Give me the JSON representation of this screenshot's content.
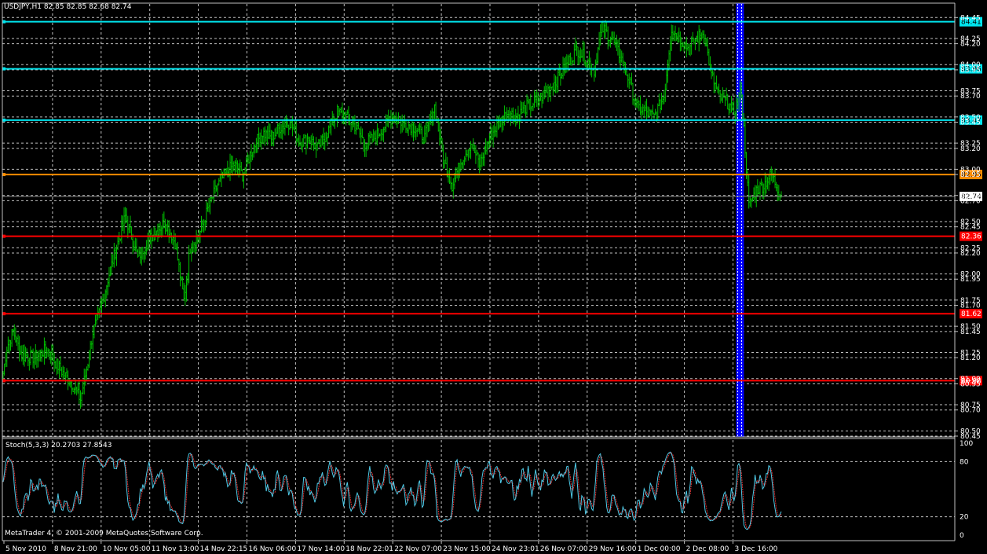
{
  "window": {
    "symbol_info": "USDJPY,H1  82.85 82.85 82.68 82.74",
    "stoch_info": "Stoch(5,3,3) 20.2703 27.8543",
    "copyright": "MetaTrader 4, © 2001-2009 MetaQuotes Software Corp."
  },
  "colors": {
    "background": "#000000",
    "grid": "#c0c0c0",
    "bars": "#00c000",
    "cyan_level": "#00e5ee",
    "orange_level": "#ff8c00",
    "red_level": "#ff0000",
    "highlight_band": "#0000ff",
    "stoch_main": "#4ec9e6",
    "stoch_signal": "#e03030"
  },
  "chart_data": [
    {
      "type": "line",
      "title": "USDJPY,H1",
      "ylim": [
        80.45,
        84.58
      ],
      "price_ticks": [
        "84.45",
        "84.25",
        "84.20",
        "84.00",
        "83.95",
        "83.75",
        "83.70",
        "83.50",
        "83.45",
        "83.25",
        "83.20",
        "83.00",
        "82.95",
        "82.75",
        "82.70",
        "82.50",
        "82.45",
        "82.25",
        "82.20",
        "82.00",
        "81.95",
        "81.75",
        "81.70",
        "81.50",
        "81.45",
        "81.25",
        "81.20",
        "81.00",
        "80.95",
        "80.75",
        "80.70",
        "80.50",
        "80.45"
      ],
      "current_price": 82.74,
      "levels": [
        {
          "label": "84.41",
          "value": 84.41,
          "kind": "cyan"
        },
        {
          "label": "83.96",
          "value": 83.96,
          "kind": "cyan"
        },
        {
          "label": "83.47",
          "value": 83.47,
          "kind": "cyan"
        },
        {
          "label": "82.95",
          "value": 82.95,
          "kind": "orange"
        },
        {
          "label": "82.36",
          "value": 82.36,
          "kind": "red"
        },
        {
          "label": "81.62",
          "value": 81.62,
          "kind": "red"
        },
        {
          "label": "80.98",
          "value": 80.98,
          "kind": "red"
        }
      ],
      "x_labels": [
        "5 Nov 2010",
        "8 Nov 21:00",
        "10 Nov 05:00",
        "11 Nov 13:00",
        "14 Nov 22:15",
        "16 Nov 06:00",
        "17 Nov 14:00",
        "18 Nov 22:01",
        "22 Nov 07:00",
        "23 Nov 15:00",
        "24 Nov 23:01",
        "26 Nov 07:00",
        "29 Nov 16:00",
        "1 Dec 00:00",
        "2 Dec 08:00",
        "3 Dec 16:00"
      ],
      "highlight_index": 15,
      "close_keypoints": [
        [
          0,
          81.05
        ],
        [
          3,
          81.3
        ],
        [
          8,
          81.45
        ],
        [
          15,
          81.22
        ],
        [
          25,
          81.2
        ],
        [
          35,
          81.28
        ],
        [
          45,
          81.1
        ],
        [
          55,
          80.95
        ],
        [
          62,
          80.8
        ],
        [
          68,
          81.15
        ],
        [
          72,
          81.45
        ],
        [
          78,
          81.65
        ],
        [
          85,
          82.0
        ],
        [
          92,
          82.3
        ],
        [
          98,
          82.55
        ],
        [
          102,
          82.4
        ],
        [
          108,
          82.15
        ],
        [
          115,
          82.3
        ],
        [
          122,
          82.4
        ],
        [
          130,
          82.5
        ],
        [
          138,
          82.3
        ],
        [
          145,
          81.75
        ],
        [
          150,
          82.25
        ],
        [
          158,
          82.4
        ],
        [
          165,
          82.65
        ],
        [
          172,
          82.85
        ],
        [
          178,
          82.95
        ],
        [
          185,
          83.05
        ],
        [
          192,
          82.95
        ],
        [
          200,
          83.2
        ],
        [
          208,
          83.35
        ],
        [
          215,
          83.3
        ],
        [
          222,
          83.4
        ],
        [
          230,
          83.45
        ],
        [
          238,
          83.25
        ],
        [
          245,
          83.3
        ],
        [
          252,
          83.2
        ],
        [
          260,
          83.35
        ],
        [
          268,
          83.55
        ],
        [
          275,
          83.5
        ],
        [
          283,
          83.4
        ],
        [
          290,
          83.25
        ],
        [
          298,
          83.3
        ],
        [
          305,
          83.4
        ],
        [
          312,
          83.5
        ],
        [
          320,
          83.45
        ],
        [
          330,
          83.4
        ],
        [
          338,
          83.3
        ],
        [
          346,
          83.6
        ],
        [
          353,
          83.1
        ],
        [
          360,
          82.85
        ],
        [
          368,
          83.1
        ],
        [
          375,
          83.25
        ],
        [
          382,
          83.05
        ],
        [
          390,
          83.3
        ],
        [
          398,
          83.45
        ],
        [
          405,
          83.55
        ],
        [
          412,
          83.5
        ],
        [
          420,
          83.6
        ],
        [
          428,
          83.65
        ],
        [
          436,
          83.75
        ],
        [
          444,
          83.85
        ],
        [
          452,
          84.0
        ],
        [
          460,
          84.15
        ],
        [
          468,
          84.05
        ],
        [
          474,
          83.95
        ],
        [
          480,
          84.35
        ],
        [
          488,
          84.25
        ],
        [
          496,
          84.05
        ],
        [
          502,
          83.85
        ],
        [
          508,
          83.6
        ],
        [
          515,
          83.55
        ],
        [
          522,
          83.5
        ],
        [
          530,
          83.7
        ],
        [
          536,
          84.35
        ],
        [
          542,
          84.25
        ],
        [
          550,
          84.15
        ],
        [
          556,
          84.25
        ],
        [
          562,
          84.3
        ],
        [
          568,
          83.9
        ],
        [
          574,
          83.7
        ],
        [
          580,
          83.65
        ],
        [
          586,
          83.55
        ],
        [
          592,
          83.75
        ],
        [
          598,
          82.65
        ],
        [
          604,
          82.8
        ],
        [
          610,
          82.85
        ],
        [
          616,
          82.95
        ],
        [
          620,
          82.85
        ],
        [
          624,
          82.75
        ]
      ]
    },
    {
      "type": "line",
      "title": "Stoch(5,3,3)",
      "ylim": [
        0,
        100
      ],
      "y_ticks": [
        "100",
        "80",
        "20",
        "0"
      ],
      "reference_lines": [
        80,
        20
      ],
      "series": [
        {
          "values_note": ""
        }
      ],
      "main_seed": 20.2703,
      "signal_seed": 27.8543
    }
  ]
}
